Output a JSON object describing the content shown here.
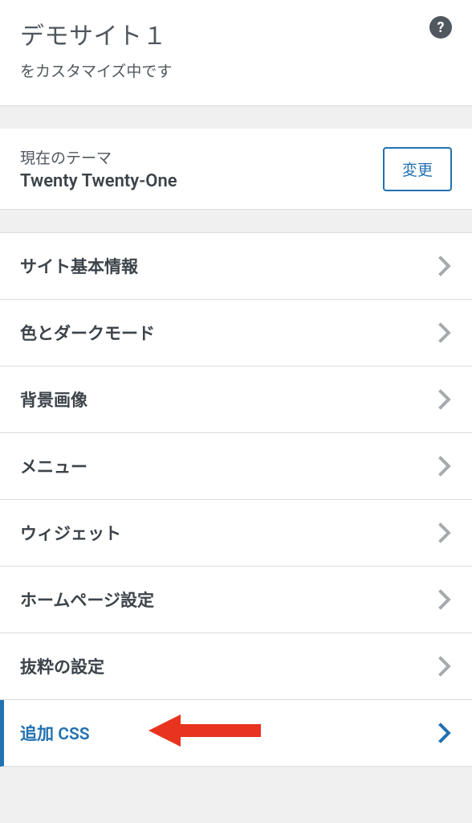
{
  "header": {
    "site_title": "デモサイト１",
    "subtitle": "をカスタマイズ中です"
  },
  "theme": {
    "label": "現在のテーマ",
    "name": "Twenty Twenty-One",
    "change_button": "変更"
  },
  "menu": {
    "items": [
      {
        "label": "サイト基本情報",
        "active": false
      },
      {
        "label": "色とダークモード",
        "active": false
      },
      {
        "label": "背景画像",
        "active": false
      },
      {
        "label": "メニュー",
        "active": false
      },
      {
        "label": "ウィジェット",
        "active": false
      },
      {
        "label": "ホームページ設定",
        "active": false
      },
      {
        "label": "抜粋の設定",
        "active": false
      },
      {
        "label": "追加 CSS",
        "active": true
      }
    ]
  }
}
